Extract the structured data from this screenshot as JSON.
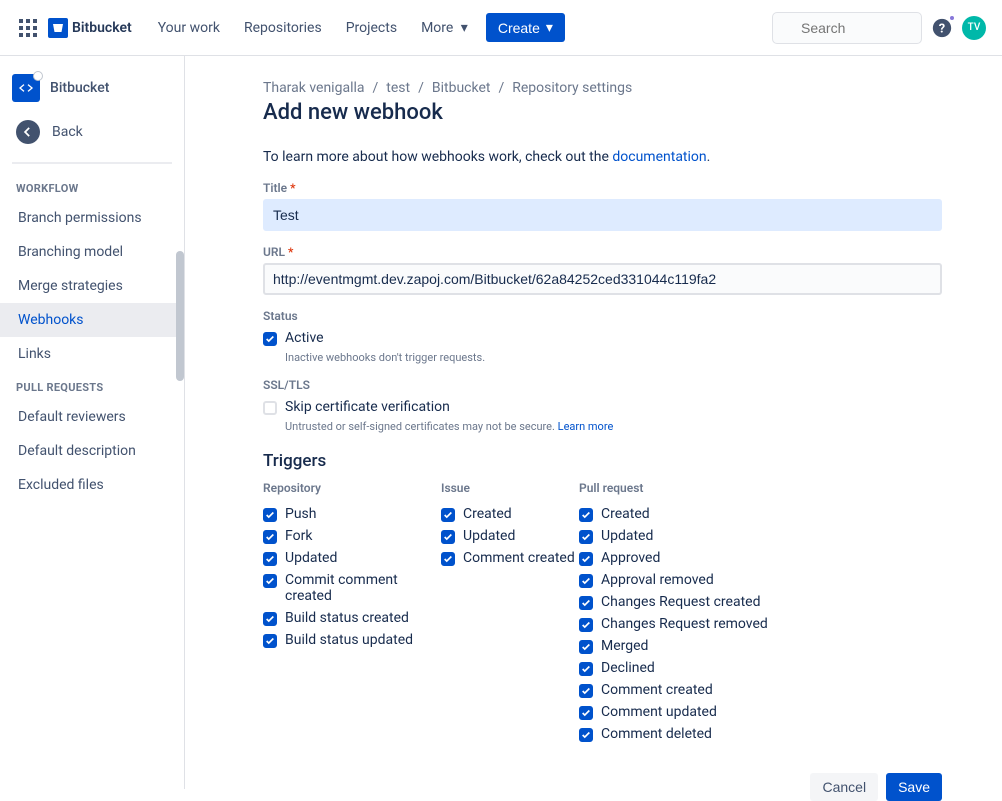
{
  "header": {
    "logo_text": "Bitbucket",
    "nav": {
      "your_work": "Your work",
      "repositories": "Repositories",
      "projects": "Projects",
      "more": "More"
    },
    "create_label": "Create",
    "search_placeholder": "Search",
    "avatar_initials": "TV"
  },
  "sidebar": {
    "repo_name": "Bitbucket",
    "back_label": "Back",
    "groups": {
      "workflow": {
        "header": "Workflow",
        "branch_permissions": "Branch permissions",
        "branching_model": "Branching model",
        "merge_strategies": "Merge strategies",
        "webhooks": "Webhooks",
        "links": "Links"
      },
      "pull_requests": {
        "header": "Pull Requests",
        "default_reviewers": "Default reviewers",
        "default_description": "Default description",
        "excluded_files": "Excluded files"
      }
    }
  },
  "breadcrumbs": {
    "owner": "Tharak venigalla",
    "project": "test",
    "repo": "Bitbucket",
    "section": "Repository settings",
    "sep": "/"
  },
  "page": {
    "title": "Add new webhook",
    "intro_prefix": "To learn more about how webhooks work, check out the ",
    "intro_link": "documentation",
    "intro_suffix": "."
  },
  "form": {
    "title": {
      "label": "Title",
      "value": "Test"
    },
    "url": {
      "label": "URL",
      "value": "http://eventmgmt.dev.zapoj.com/Bitbucket/62a84252ced331044c119fa2"
    },
    "status": {
      "label": "Status",
      "active_label": "Active",
      "active_helper": "Inactive webhooks don't trigger requests."
    },
    "ssl": {
      "label": "SSL/TLS",
      "skip_label": "Skip certificate verification",
      "skip_helper": "Untrusted or self-signed certificates may not be secure. ",
      "learn_more": "Learn more"
    }
  },
  "triggers": {
    "heading": "Triggers",
    "repository": {
      "header": "Repository",
      "items": {
        "push": "Push",
        "fork": "Fork",
        "updated": "Updated",
        "commit_comment": "Commit comment created",
        "build_created": "Build status created",
        "build_updated": "Build status updated"
      }
    },
    "issue": {
      "header": "Issue",
      "items": {
        "created": "Created",
        "updated": "Updated",
        "comment_created": "Comment created"
      }
    },
    "pr": {
      "header": "Pull request",
      "items": {
        "created": "Created",
        "updated": "Updated",
        "approved": "Approved",
        "approval_removed": "Approval removed",
        "cr_created": "Changes Request created",
        "cr_removed": "Changes Request removed",
        "merged": "Merged",
        "declined": "Declined",
        "comment_created": "Comment created",
        "comment_updated": "Comment updated",
        "comment_deleted": "Comment deleted"
      }
    }
  },
  "footer": {
    "cancel": "Cancel",
    "save": "Save"
  }
}
